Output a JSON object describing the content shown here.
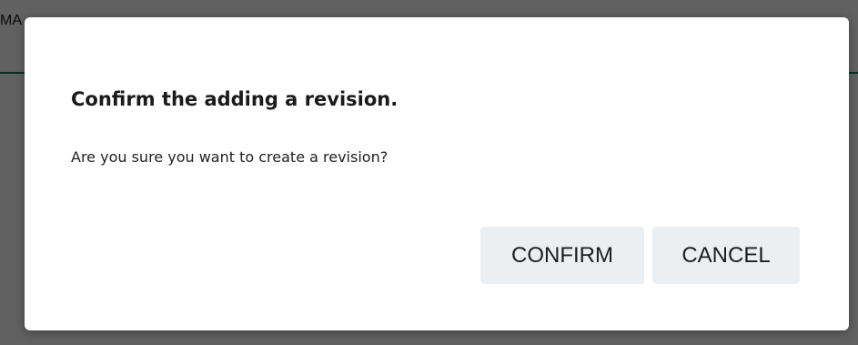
{
  "background": {
    "fragment_text": "MA",
    "accent_color": "#1f7a5c"
  },
  "dialog": {
    "title": "Confirm the adding a revision.",
    "message": "Are you sure you want to create a revision?",
    "confirm_label": "CONFIRM",
    "cancel_label": "CANCEL"
  },
  "colors": {
    "overlay": "rgba(0,0,0,0.62)",
    "dialog_bg": "#ffffff",
    "button_bg": "#eceff1"
  }
}
